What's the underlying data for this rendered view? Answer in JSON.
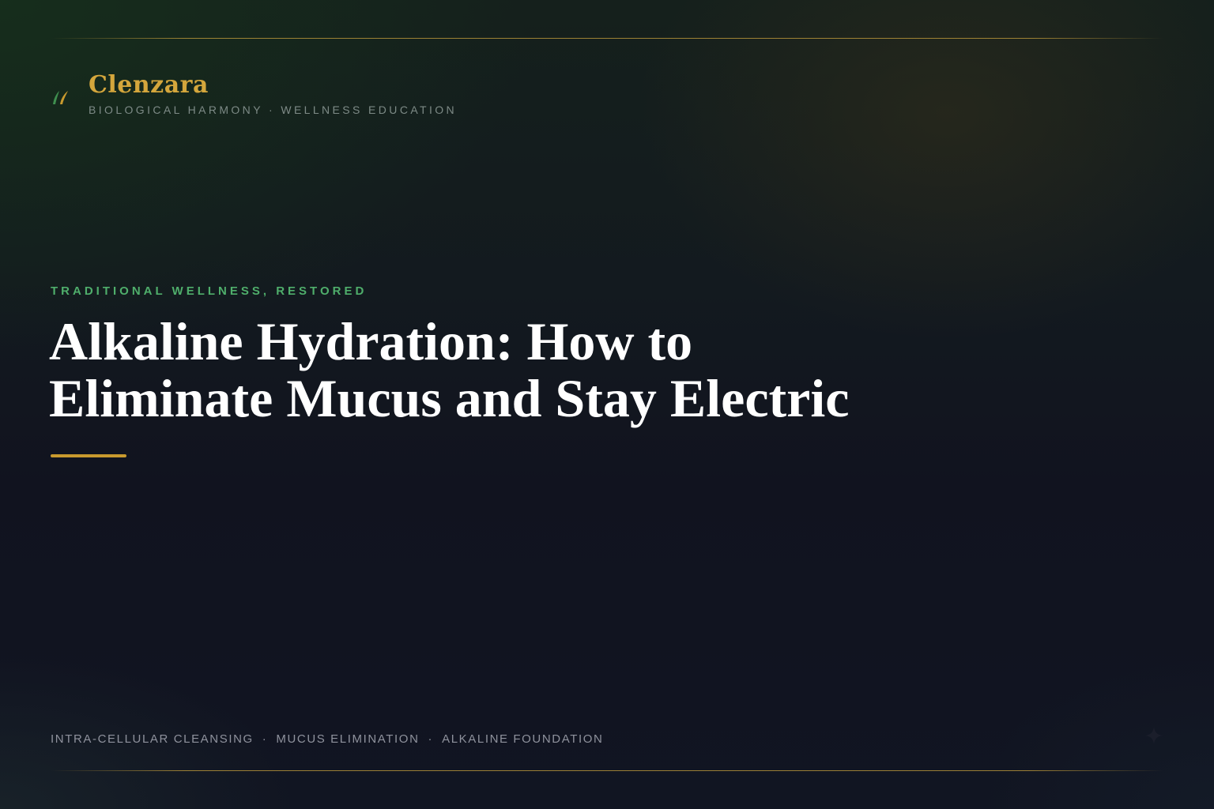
{
  "brand": {
    "name": "Clenzara",
    "tagline": "BIOLOGICAL HARMONY · WELLNESS EDUCATION",
    "icon": "leaf-icon"
  },
  "hero": {
    "eyebrow": "TRADITIONAL WELLNESS, RESTORED",
    "title_line1": "Alkaline Hydration: How to",
    "title_line2": "Eliminate Mucus and Stay Electric"
  },
  "footer": {
    "topics": [
      "INTRA-CELLULAR CLEANSING",
      "MUCUS ELIMINATION",
      "ALKALINE FOUNDATION"
    ],
    "separator": "·",
    "icon": "sparkle-icon"
  },
  "colors": {
    "brand_gold": "#d4a63c",
    "eyebrow_green": "#4fae6b",
    "accent_bar": "#c99a2e",
    "background": "#11131f",
    "muted_text": "#8f929d"
  }
}
